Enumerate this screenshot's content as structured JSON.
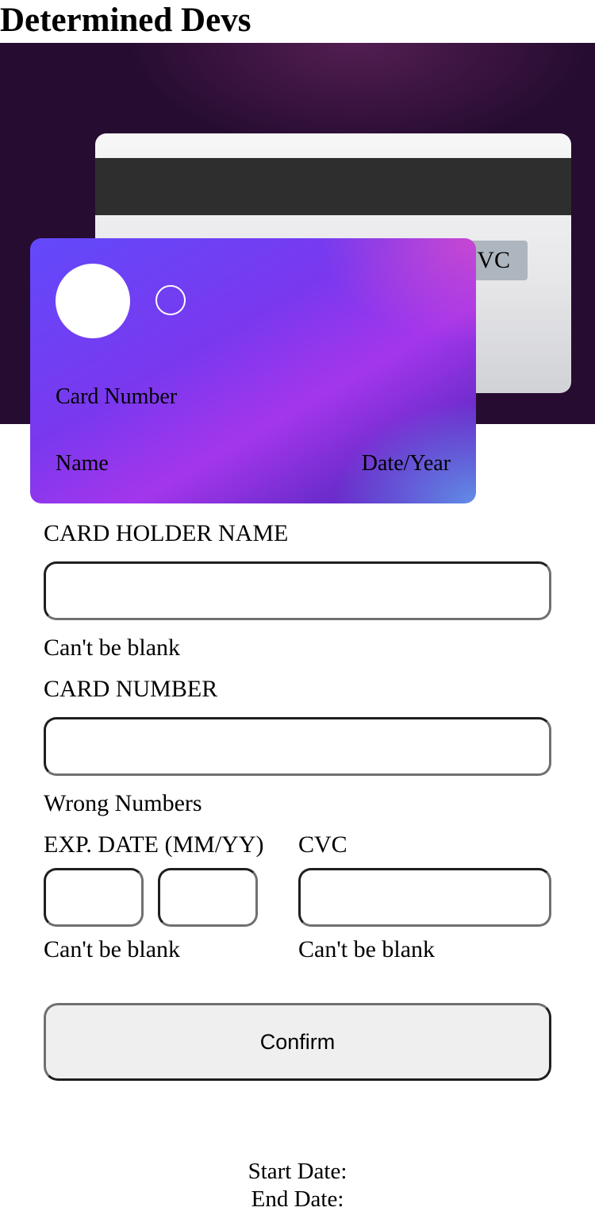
{
  "site": {
    "title": "Determined Devs"
  },
  "card_back": {
    "cvc": "CVC"
  },
  "card_front": {
    "number": "Card Number",
    "name": "Name",
    "date": "Date/Year"
  },
  "form": {
    "holder": {
      "label": "CARD HOLDER NAME",
      "value": "",
      "placeholder": "",
      "error": "Can't be blank"
    },
    "number": {
      "label": "CARD NUMBER",
      "value": "",
      "placeholder": "",
      "error": "Wrong Numbers"
    },
    "exp": {
      "label": "EXP. DATE (MM/YY)",
      "month_value": "",
      "year_value": "",
      "error": "Can't be blank"
    },
    "cvc": {
      "label": "CVC",
      "value": "",
      "error": "Can't be blank"
    },
    "confirm_label": "Confirm"
  },
  "footer": {
    "start_date": "Start Date:",
    "end_date": "End Date:"
  },
  "colors": {
    "hero_bg": "#260c30",
    "card_front_start": "#6249fb",
    "card_front_end": "#5a21c3",
    "card_back_stripe": "#2e2e2e",
    "cvc_strip": "#adb5be"
  }
}
